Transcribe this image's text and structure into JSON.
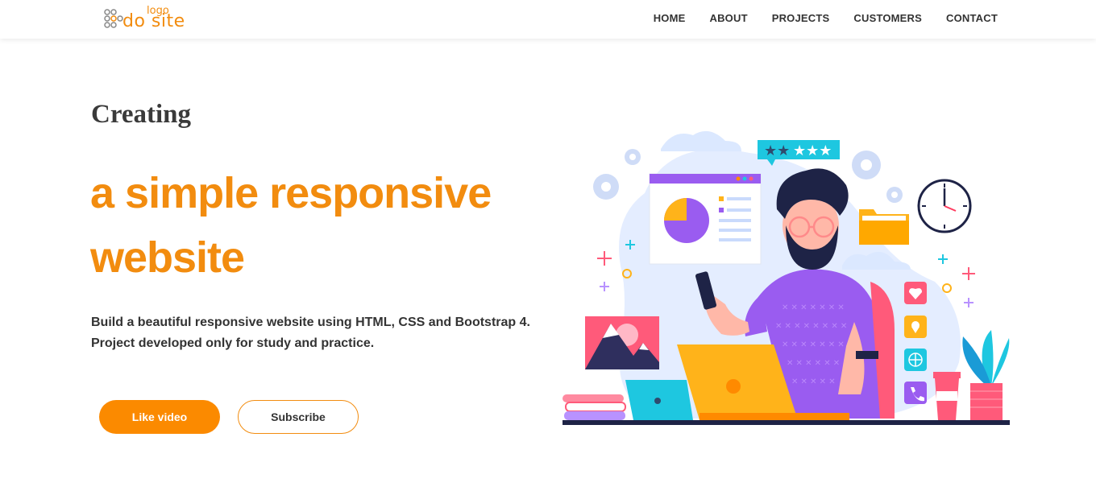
{
  "header": {
    "logo": {
      "small": "logo",
      "big": "do site"
    },
    "nav": [
      "HOME",
      "ABOUT",
      "PROJECTS",
      "CUSTOMERS",
      "CONTACT"
    ]
  },
  "hero": {
    "subtitle": "Creating",
    "title": "a simple responsive website",
    "description_line1": "Build a beautiful responsive website using HTML, CSS and Bootstrap 4.",
    "description_line2": "Project developed only for study and practice.",
    "primary_button": "Like video",
    "secondary_button": "Subscribe"
  },
  "colors": {
    "accent": "#fb8a00",
    "text": "#333333",
    "purple": "#9a5cf0",
    "yellow": "#ffb31a",
    "blue_light": "#dbe8ff"
  },
  "illustration": {
    "icons": [
      "stars-rating-icon",
      "clock-icon",
      "folder-icon",
      "heart-icon",
      "location-pin-icon",
      "globe-icon",
      "phone-icon",
      "gear-icon",
      "pie-chart-icon",
      "mountain-picture-icon",
      "laptop-icon",
      "plant-icon",
      "coffee-cup-icon",
      "books-icon"
    ]
  }
}
